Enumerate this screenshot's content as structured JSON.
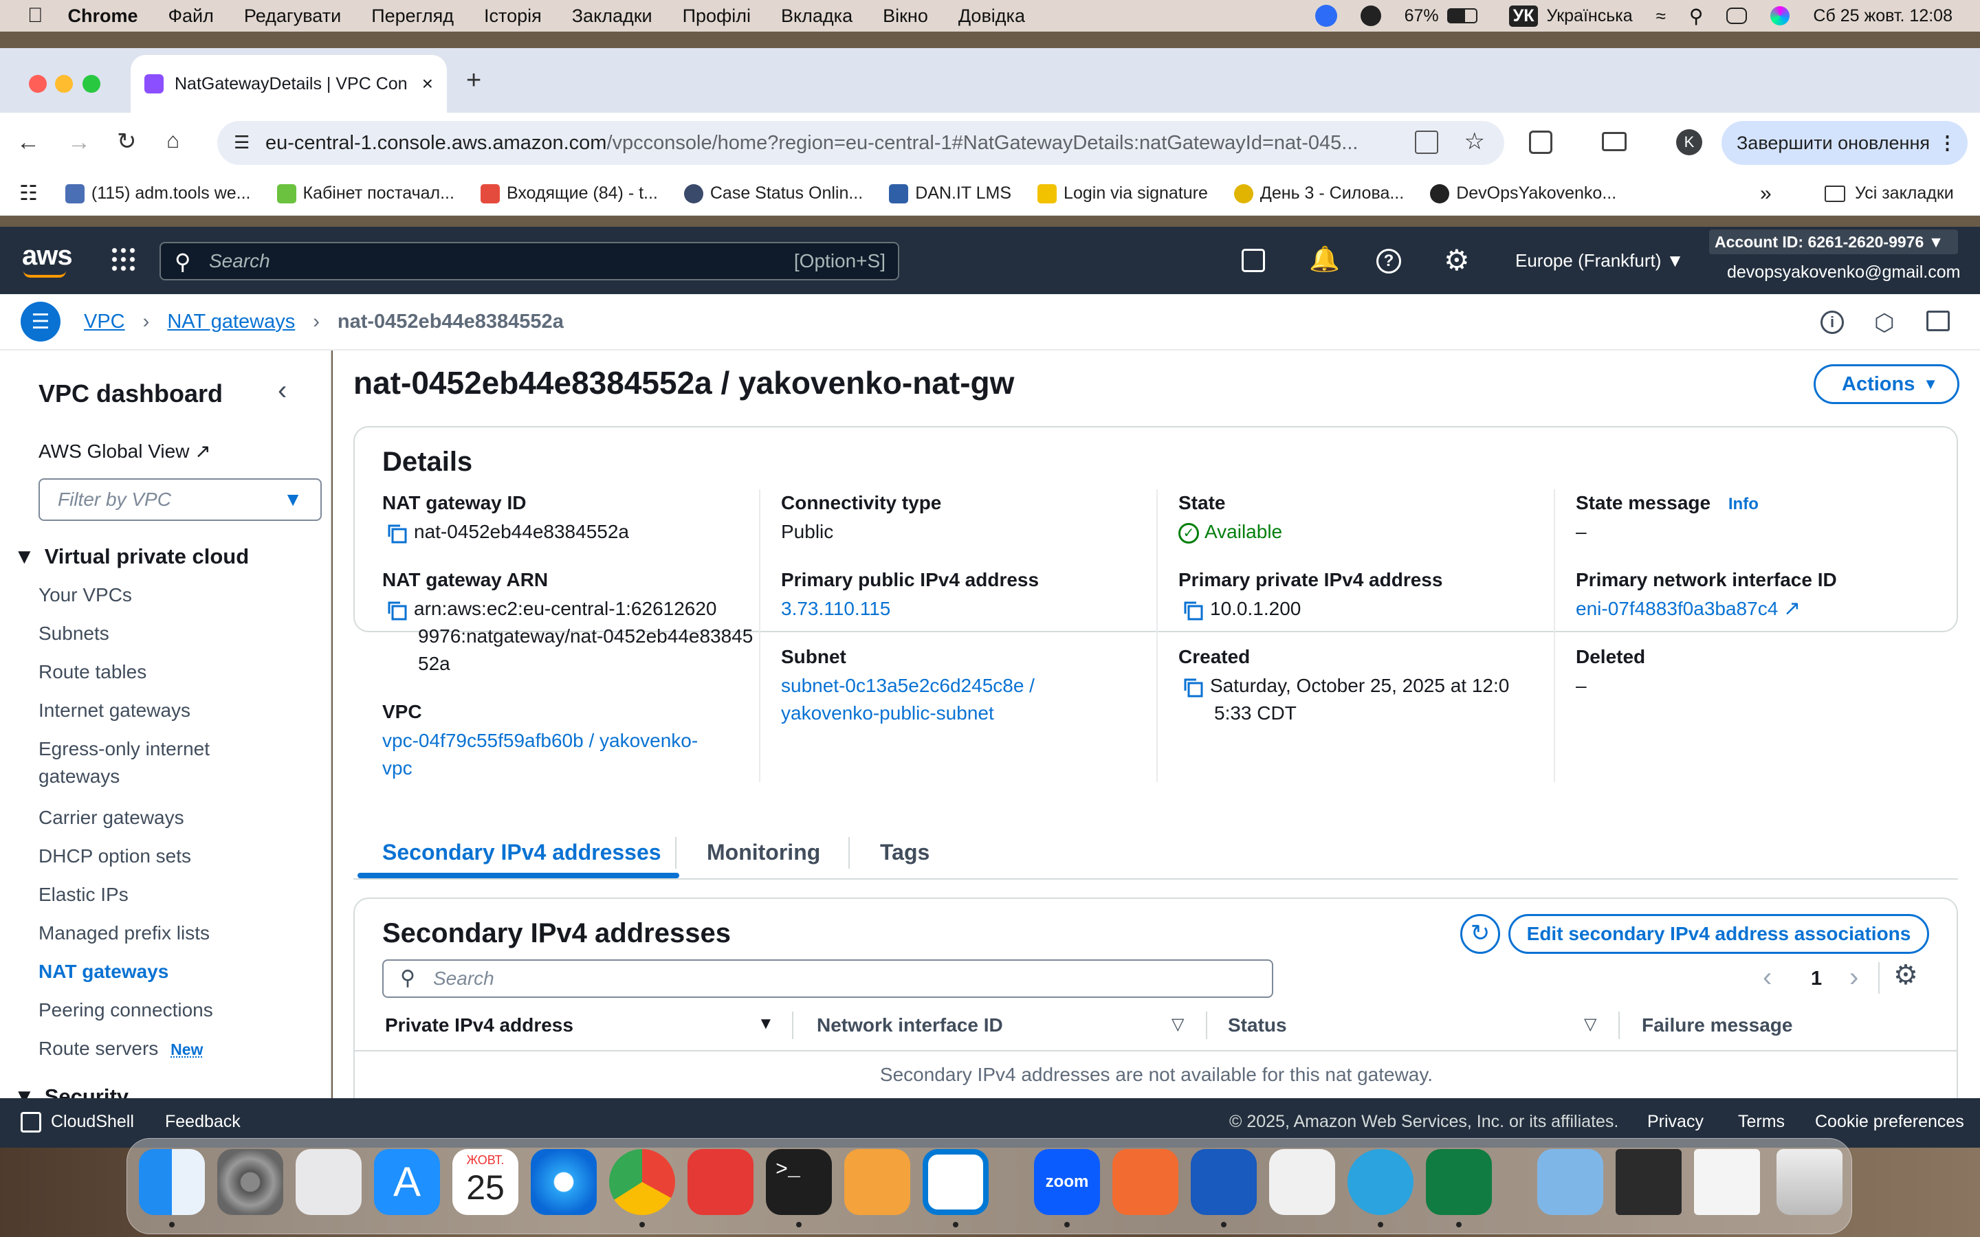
{
  "menubar": {
    "app": "Chrome",
    "menus": [
      "Файл",
      "Редагувати",
      "Перегляд",
      "Історія",
      "Закладки",
      "Профілі",
      "Вкладка",
      "Вікно",
      "Довідка"
    ],
    "battery": "67%",
    "input_badge": "УК",
    "language": "Українська",
    "datetime": "Сб 25 жовт. 12:08"
  },
  "browser": {
    "tab_title": "NatGatewayDetails | VPC Con",
    "url_host": "eu-central-1.console.aws.amazon.com",
    "url_path": "/vpcconsole/home?region=eu-central-1#NatGatewayDetails:natGatewayId=nat-045...",
    "profile_initial": "K",
    "update_button": "Завершити оновлення",
    "bookmarks": [
      {
        "label": "(115) adm.tools we...",
        "color": "#4b6fb5"
      },
      {
        "label": "Кабінет постачал...",
        "color": "#6ac23f"
      },
      {
        "label": "Входящие (84) - t...",
        "color": "#e54b3c"
      },
      {
        "label": "Case Status Onlin...",
        "color": "#3a4a6b"
      },
      {
        "label": "DAN.IT LMS",
        "color": "#2f5fa7"
      },
      {
        "label": "Login via signature",
        "color": "#f2c200"
      },
      {
        "label": "День 3 - Силова...",
        "color": "#e0b400"
      },
      {
        "label": "DevOpsYakovenko...",
        "color": "#222222"
      }
    ],
    "all_bookmarks": "Усі закладки"
  },
  "aws": {
    "logo": "aws",
    "search_placeholder": "Search",
    "search_shortcut": "[Option+S]",
    "region": "Europe (Frankfurt)",
    "account": "Account ID: 6261-2620-9976",
    "email": "devopsyakovenko@gmail.com"
  },
  "breadcrumb": [
    "VPC",
    "NAT gateways",
    "nat-0452eb44e8384552a"
  ],
  "sidebar": {
    "title": "VPC dashboard",
    "global_view": "AWS Global View",
    "filter_placeholder": "Filter by VPC",
    "section": "Virtual private cloud",
    "items": [
      "Your VPCs",
      "Subnets",
      "Route tables",
      "Internet gateways",
      "Egress-only internet",
      "gateways",
      "Carrier gateways",
      "DHCP option sets",
      "Elastic IPs",
      "Managed prefix lists",
      "NAT gateways",
      "Peering connections",
      "Route servers"
    ],
    "new_badge": "New",
    "next_section": "Security"
  },
  "page": {
    "title": "nat-0452eb44e8384552a / yakovenko-nat-gw",
    "actions": "Actions"
  },
  "details": {
    "heading": "Details",
    "nat_id_label": "NAT gateway ID",
    "nat_id": "nat-0452eb44e8384552a",
    "arn_label": "NAT gateway ARN",
    "arn_l1": "arn:aws:ec2:eu-central-1:62612620",
    "arn_l2": "9976:natgateway/nat-0452eb44e83845",
    "arn_l3": "52a",
    "vpc_label": "VPC",
    "vpc_l1": "vpc-04f79c55f59afb60b / yakovenko-",
    "vpc_l2": "vpc",
    "conn_label": "Connectivity type",
    "conn": "Public",
    "pub_ip_label": "Primary public IPv4 address",
    "pub_ip": "3.73.110.115",
    "subnet_label": "Subnet",
    "subnet_l1": "subnet-0c13a5e2c6d245c8e /",
    "subnet_l2": "yakovenko-public-subnet",
    "state_label": "State",
    "state": "Available",
    "priv_ip_label": "Primary private IPv4 address",
    "priv_ip": "10.0.1.200",
    "created_label": "Created",
    "created_l1": "Saturday, October 25, 2025 at 12:0",
    "created_l2": "5:33 CDT",
    "msg_label": "State message",
    "info": "Info",
    "msg": "–",
    "eni_label": "Primary network interface ID",
    "eni": "eni-07f4883f0a3ba87c4",
    "deleted_label": "Deleted",
    "deleted": "–",
    "state_color": "#037f0c"
  },
  "tabs": [
    "Secondary IPv4 addresses",
    "Monitoring",
    "Tags"
  ],
  "secondary": {
    "heading": "Secondary IPv4 addresses",
    "edit_button": "Edit secondary IPv4 address associations",
    "search_placeholder": "Search",
    "page": "1",
    "columns": [
      "Private IPv4 address",
      "Network interface ID",
      "Status",
      "Failure message"
    ],
    "empty": "Secondary IPv4 addresses are not available for this nat gateway."
  },
  "footer": {
    "cloudshell": "CloudShell",
    "feedback": "Feedback",
    "copyright": "© 2025, Amazon Web Services, Inc. or its affiliates.",
    "privacy": "Privacy",
    "terms": "Terms",
    "cookies": "Cookie preferences"
  },
  "dock": {
    "calendar_month": "ЖОВТ.",
    "calendar_day": "25",
    "zoom": "zoom"
  }
}
